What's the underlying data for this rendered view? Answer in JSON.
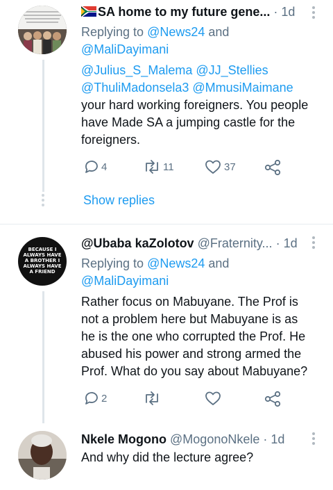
{
  "tweet1": {
    "display_name": "SA home to my future gene...",
    "flag_icon": "south-africa-flag-icon",
    "time": "· 1d",
    "replying_prefix": "Replying to ",
    "replying_user1": "@News24",
    "replying_and": " and",
    "replying_user2": "@MaliDayimani",
    "mention1": "@Julius_S_Malema",
    "mention2": "@JJ_Stellies",
    "mention3": "@ThuliMadonsela3",
    "mention4": "@MmusiMaimane",
    "body_line1": "your hard working foreigners. You people",
    "body_line2": "have Made SA a jumping castle for the",
    "body_line3": "foreigners.",
    "replies": "4",
    "retweets": "11",
    "likes": "37"
  },
  "show_replies": "Show replies",
  "tweet2": {
    "display_name": "@Ubaba kaZolotov",
    "handle": "@Fraternity...",
    "time": "· 1d",
    "avatar_lines": [
      "BECAUSE I",
      "ALWAYS HAVE",
      "A BROTHER I",
      "ALWAYS HAVE",
      "A FRIEND"
    ],
    "replying_prefix": "Replying to ",
    "replying_user1": "@News24",
    "replying_and": " and",
    "replying_user2": "@MaliDayimani",
    "body_line1": "Rather focus on Mabuyane. The Prof is",
    "body_line2": "not a problem here but Mabuyane is as",
    "body_line3": "he is the one who corrupted the Prof. He",
    "body_line4": "abused his power and strong armed the",
    "body_line5": "Prof. What do you say about Mabuyane?",
    "replies": "2"
  },
  "tweet3": {
    "display_name": "Nkele Mogono",
    "handle": "@MogonoNkele",
    "time": "· 1d",
    "body_line1": "And why did the lecture agree?"
  },
  "colors": {
    "link": "#1d9bf0",
    "secondary": "#5b7083",
    "text": "#0f1419"
  }
}
